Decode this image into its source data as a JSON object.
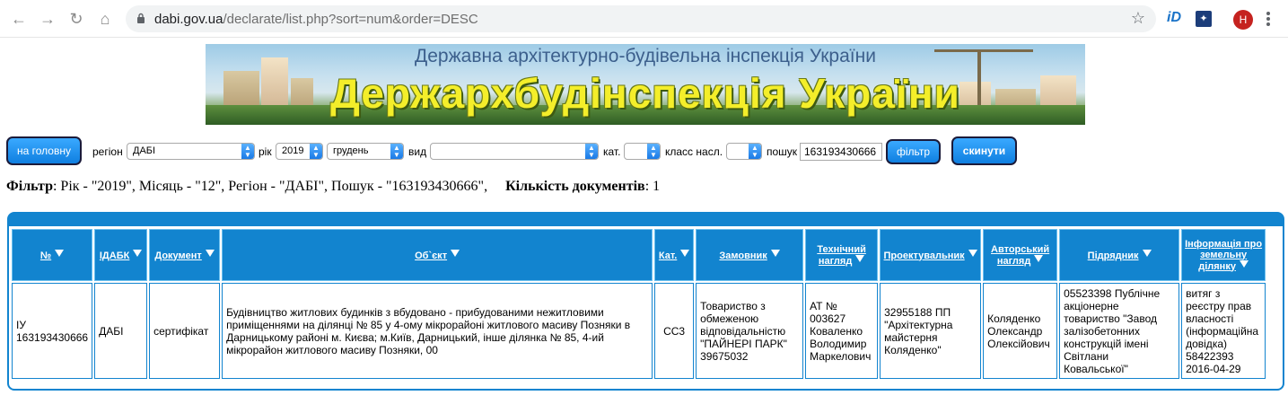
{
  "browser": {
    "url_host": "dabi.gov.ua",
    "url_path": "/declarate/list.php?sort=num&order=DESC",
    "extension_id_label": "iD",
    "avatar_letter": "H"
  },
  "banner": {
    "subtitle": "Державна архітектурно-будівельна інспекція України",
    "title": "Держархбудінспекція України"
  },
  "toolbar": {
    "home_button": "на головну",
    "region_label": "регіон",
    "region_value": "ДАБІ",
    "year_label": "рік",
    "year_value": "2019",
    "month_value": "грудень",
    "type_label": "вид",
    "type_value": "",
    "category_label": "кат.",
    "category_value": "",
    "consequence_label": "класс насл.",
    "consequence_value": "",
    "search_label": "пошук",
    "search_value": "163193430666",
    "filter_button": "фільтр",
    "reset_button": "скинути"
  },
  "summary": {
    "filter_label": "Фільтр",
    "filter_text": ": Рік - \"2019\", Місяць - \"12\", Регіон - \"ДАБІ\", Пошук - \"163193430666\",",
    "count_label": "Кількість документів",
    "count_value": ": 1"
  },
  "table": {
    "headers": [
      "№",
      "ІДАБК",
      "Документ",
      "Об`єкт",
      "Кат.",
      "Замовник",
      "Технічний нагляд",
      "Проектувальник",
      "Авторський нагляд",
      "Підрядник",
      "Інформація про земельну ділянку"
    ],
    "rows": [
      {
        "num": "ІУ 163193430666",
        "idabk": "ДАБІ",
        "document": "сертифікат",
        "object": "Будівництво житлових будинків з вбудовано - прибудованими нежитловими приміщеннями на ділянці № 85 у 4-ому мікрорайоні житлового масиву Позняки в Дарницькому районі м. Києва; м.Київ, Дарницький, інше ділянка № 85, 4-ий мікрорайон житлового масиву Позняки, 00",
        "category": "СС3",
        "customer": "Товариство з обмеженою відповідальністю \"ПАЙНЕРІ ПАРК\" 39675032",
        "tech_supervision": "АТ № 003627 Коваленко Володимир Маркелович",
        "designer": "32955188 ПП \"Архітектурна майстерня Коляденко\"",
        "author_supervision": "Коляденко Олександр Олексійович",
        "contractor": "05523398 Публічне акціонерне товариство \"Завод залізобетонних конструкцій імені Світлани Ковальської\"",
        "land_info": "витяг з реєстру прав власності (інформаційна довідка) 58422393 2016-04-29"
      }
    ]
  }
}
